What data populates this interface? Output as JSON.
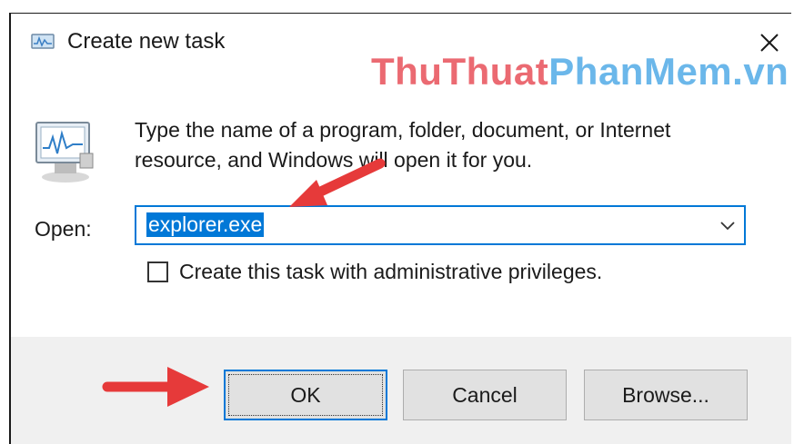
{
  "window": {
    "title": "Create new task",
    "close_icon": "close-icon",
    "titlebar_color": "#ffffff",
    "accent_color": "#1fa67a"
  },
  "watermark": {
    "part1": "ThuThuat",
    "part2": "PhanMem.vn"
  },
  "content": {
    "description": "Type the name of a program, folder, document, or Internet resource, and Windows will open it for you.",
    "open_label": "Open:",
    "open_value": "explorer.exe",
    "checkbox_label": "Create this task with administrative privileges.",
    "checkbox_checked": false
  },
  "buttons": {
    "ok": "OK",
    "cancel": "Cancel",
    "browse": "Browse..."
  },
  "colors": {
    "selection": "#0078d7",
    "annotation_arrow": "#e63a3a",
    "footer_bg": "#f0f0f0"
  }
}
